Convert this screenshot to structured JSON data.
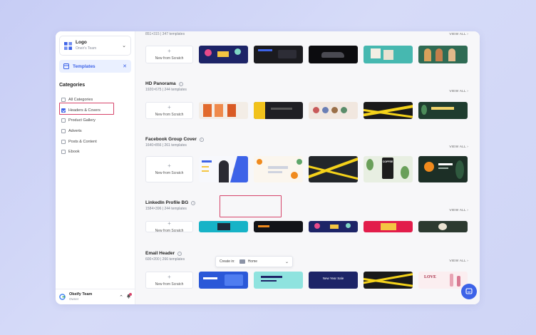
{
  "sidebar": {
    "team_name": "Logo",
    "team_sub": "Oneir's Team",
    "templates_label": "Templates",
    "categories_title": "Categories",
    "categories": [
      {
        "label": "All Categories",
        "checked": false
      },
      {
        "label": "Headers & Covers",
        "checked": true
      },
      {
        "label": "Product Gallery",
        "checked": false
      },
      {
        "label": "Adverts",
        "checked": false
      },
      {
        "label": "Posts & Content",
        "checked": false
      },
      {
        "label": "Ebook",
        "checked": false
      }
    ],
    "footer_name": "Okeify Team",
    "footer_role": "Owner"
  },
  "sections": [
    {
      "title": "",
      "sub": "851×315 | 347 templates",
      "view_all": "VIEW ALL ›",
      "new_label": "New from Scratch"
    },
    {
      "title": "HD Panorama",
      "sub": "1920×675 | 244 templates",
      "view_all": "VIEW ALL ›",
      "new_label": "New from Scratch"
    },
    {
      "title": "Facebook Group Cover",
      "sub": "1640×856 | 261 templates",
      "view_all": "VIEW ALL ›",
      "new_label": "New from Scratch"
    },
    {
      "title": "LinkedIn Profile BG",
      "sub": "1584×396 | 244 templates",
      "view_all": "VIEW ALL ›",
      "new_label": "New from Scratch"
    },
    {
      "title": "Email Header",
      "sub": "600×200 | 266 templates",
      "view_all": "VIEW ALL ›",
      "new_label": "New from Scratch"
    }
  ],
  "thumb_text": {
    "fb_coffee": "COFFEE",
    "email_sale": "New Year Sale",
    "email_love": "LOVE"
  },
  "create_bar": {
    "label": "Create in:",
    "location": "Home"
  },
  "colors": {
    "accent": "#3d63e8",
    "highlight": "#d6446a"
  }
}
